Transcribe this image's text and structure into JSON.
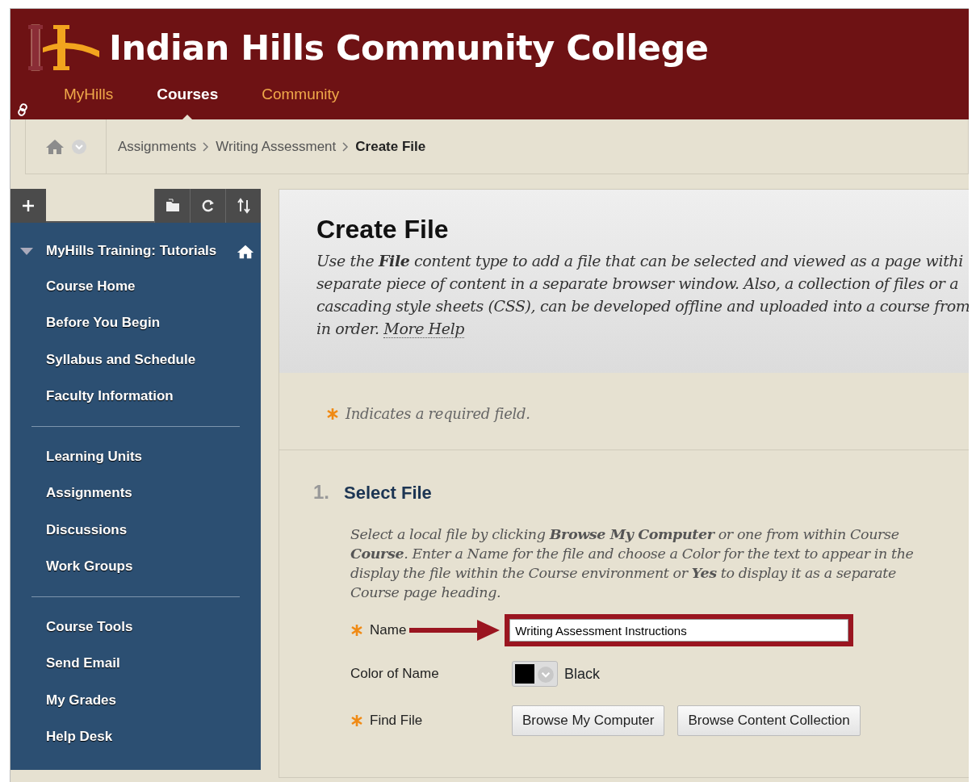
{
  "header": {
    "title": "Indian Hills Community College"
  },
  "nav_tabs": [
    {
      "label": "MyHills",
      "selected": false
    },
    {
      "label": "Courses",
      "selected": true
    },
    {
      "label": "Community",
      "selected": false
    }
  ],
  "breadcrumb": [
    {
      "label": "Assignments",
      "current": false
    },
    {
      "label": "Writing Assessment",
      "current": false
    },
    {
      "label": "Create File",
      "current": true
    }
  ],
  "sidebar": {
    "course_title": "MyHills Training: Tutorials",
    "expanded": true,
    "sections": [
      [
        "Course Home",
        "Before You Begin",
        "Syllabus and Schedule",
        "Faculty Information"
      ],
      [
        "Learning Units",
        "Assignments",
        "Discussions",
        "Work Groups"
      ],
      [
        "Course Tools",
        "Send Email",
        "My Grades",
        "Help Desk"
      ]
    ]
  },
  "page": {
    "title": "Create File",
    "description_lines": [
      "Use the **File** content type to add a file that can be selected and viewed as a page withi",
      "separate piece of content in a separate browser window. Also, a collection of files or a",
      "cascading style sheets (CSS), can be developed offline and uploaded into a course from",
      "in order."
    ],
    "more_help_link": "More Help",
    "required_note": "Indicates a required field.",
    "step": {
      "number": "1.",
      "title": "Select File",
      "instruction_lines": [
        "Select a local file by clicking **Browse My Computer** or one from within Course",
        "**Course**. Enter a Name for the file and choose a Color for the text to appear in the",
        "display the file within the Course environment or **Yes** to display it as a separate",
        "Course page heading."
      ],
      "fields": [
        {
          "kind": "text",
          "label": "Name",
          "required": true,
          "value": "Writing Assessment Instructions",
          "highlighted": true
        },
        {
          "kind": "color",
          "label": "Color of Name",
          "required": false,
          "value": "Black",
          "color": "#000000"
        },
        {
          "kind": "buttons",
          "label": "Find File",
          "required": true,
          "buttons": [
            "Browse My Computer",
            "Browse Content Collection"
          ]
        }
      ]
    }
  }
}
